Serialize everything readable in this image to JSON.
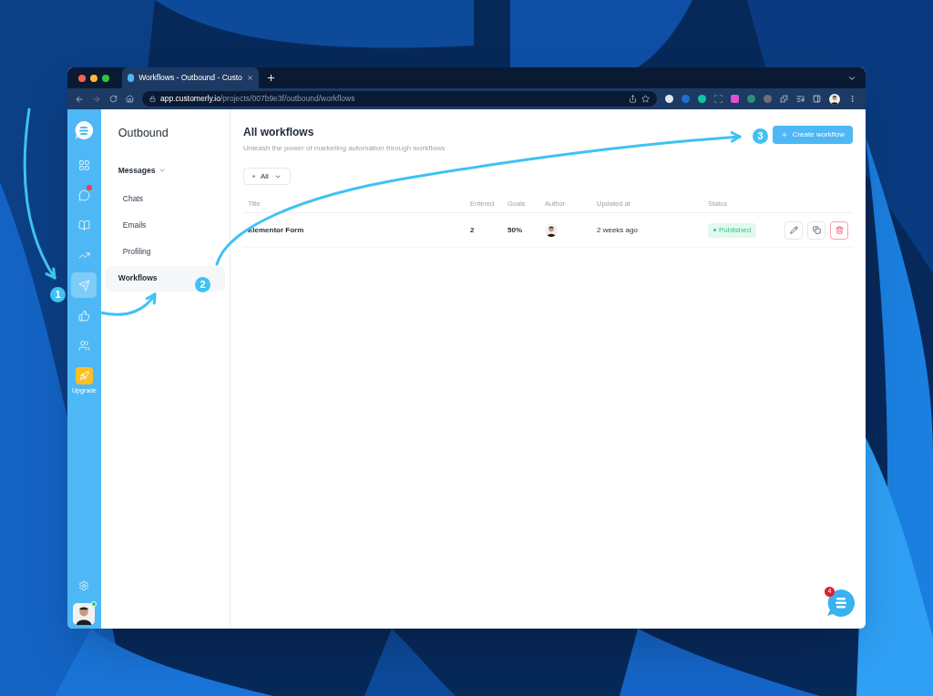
{
  "browser": {
    "tab_title": "Workflows - Outbound - Custo",
    "url_host": "app.customerly.io",
    "url_path": "/projects/007b9e3f/outbound/workflows"
  },
  "rail": {
    "items": [
      {
        "kind": "grid",
        "selected": false,
        "badge": false
      },
      {
        "kind": "chat",
        "selected": false,
        "badge": true
      },
      {
        "kind": "book",
        "selected": false,
        "badge": false
      },
      {
        "kind": "chart",
        "selected": false,
        "badge": false
      },
      {
        "kind": "send",
        "selected": true,
        "badge": false
      },
      {
        "kind": "like",
        "selected": false,
        "badge": false
      },
      {
        "kind": "users",
        "selected": false,
        "badge": false
      }
    ],
    "upgrade_label": "Upgrade"
  },
  "subnav": {
    "title": "Outbound",
    "group": {
      "label": "Messages",
      "expanded": true
    },
    "items": [
      {
        "label": "Chats",
        "selected": false
      },
      {
        "label": "Emails",
        "selected": false
      },
      {
        "label": "Profiling",
        "selected": false
      },
      {
        "label": "Workflows",
        "selected": true
      }
    ]
  },
  "main": {
    "title": "All workflows",
    "subtitle": "Unleash the power of marketing automation through workflows",
    "filter": "All",
    "create_button": "Create workflow",
    "table": {
      "columns": [
        "Title",
        "Entered",
        "Goals",
        "Author",
        "Updated at",
        "Status"
      ],
      "rows": [
        {
          "title": "Elementor Form",
          "entered": "2",
          "goals": "50%",
          "updated": "2 weeks ago",
          "status": "Published"
        }
      ]
    }
  },
  "chat_launcher": {
    "badge": "4"
  },
  "annotations": [
    "1",
    "2",
    "3"
  ]
}
